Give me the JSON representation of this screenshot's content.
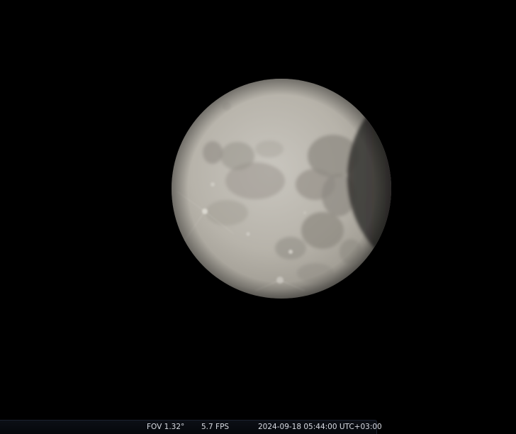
{
  "window": {
    "background_color": "#000000"
  },
  "view": {
    "object": "moon-icon",
    "phase_note_color": "#bdb8ad"
  },
  "status_bar": {
    "fov": "FOV 1.32°",
    "fps": "5.7 FPS",
    "datetime": "2024-09-18 05:44:00 UTC+03:00",
    "text_color": "#d8dbe2"
  }
}
